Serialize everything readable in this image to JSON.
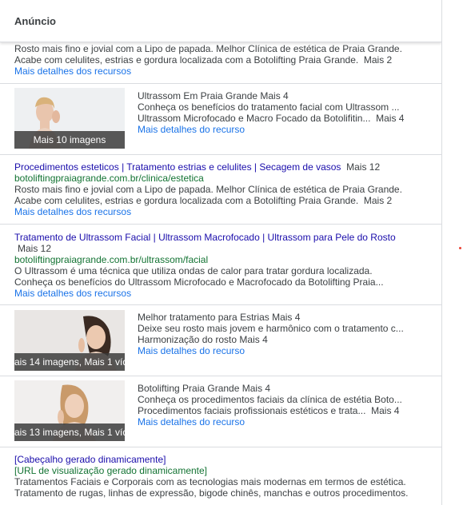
{
  "header": {
    "title": "Anúncio"
  },
  "blocks": {
    "b1": {
      "line1": "Rosto mais fino e jovial com a Lipo de papada. Melhor Clínica de estética de Praia Grande.",
      "line2": "Acabe com celulites, estrias e gordura localizada com a Botolifting Praia Grande.",
      "more": "Mais 2",
      "link": "Mais detalhes dos recursos"
    },
    "b2": {
      "image_caption": "Mais 10 imagens",
      "title": "Ultrassom Em Praia Grande Mais 4",
      "line1": "Conheça os benefícios do tratamento facial com Ultrassom ...",
      "line2": "Ultrassom Microfocado e Macro Focado da Botolifitin...",
      "more": "Mais 4",
      "link": "Mais detalhes do recurso"
    },
    "b3": {
      "title": "Procedimentos esteticos | Tratamento estrias e celulites | Secagem de vasos",
      "title_more": "Mais 12",
      "url": "botoliftingpraiagrande.com.br/clinica/estetica",
      "line1": "Rosto mais fino e jovial com a Lipo de papada. Melhor Clínica de estética de Praia Grande.",
      "line2": "Acabe com celulites, estrias e gordura localizada com a Botolifting Praia Grande.",
      "more": "Mais 2",
      "link": "Mais detalhes dos recursos"
    },
    "b4": {
      "title": "Tratamento de Ultrassom Facial | Ultrassom Macrofocado | Ultrassom para Pele do Rosto",
      "title_more": "Mais 12",
      "url": "botoliftingpraiagrande.com.br/ultrassom/facial",
      "line1": "O Ultrassom é uma técnica que utiliza ondas de calor para tratar gordura localizada.",
      "line2": "Conheça os benefícios do Ultrassom Microfocado e Macrofocado da Botolifting Praia...",
      "link": "Mais detalhes dos recursos"
    },
    "b5": {
      "image_caption": "ais 14 imagens, Mais 1 víd",
      "title": "Melhor tratamento para Estrias Mais 4",
      "line1": "Deixe seu rosto mais jovem e harmônico com o tratamento c...",
      "line2": "Harmonização do rosto Mais 4",
      "link": "Mais detalhes do recurso"
    },
    "b6": {
      "image_caption": "ais 13 imagens, Mais 1 víd",
      "title": "Botolifting Praia Grande Mais 4",
      "line1": "Conheça os procedimentos faciais da clínica de estétia Boto...",
      "line2": "Procedimentos faciais profissionais estéticos e trata...",
      "more": "Mais 4",
      "link": "Mais detalhes do recurso"
    },
    "b7": {
      "title": "[Cabeçalho gerado dinamicamente]",
      "url": "[URL de visualização gerado dinamicamente]",
      "line1": "Tratamentos Faciais e Corporais com as tecnologias mais modernas em termos de estética.",
      "line2": "Tratamento de rugas, linhas de expressão, bigode chinês, manchas e outros procedimentos."
    }
  }
}
